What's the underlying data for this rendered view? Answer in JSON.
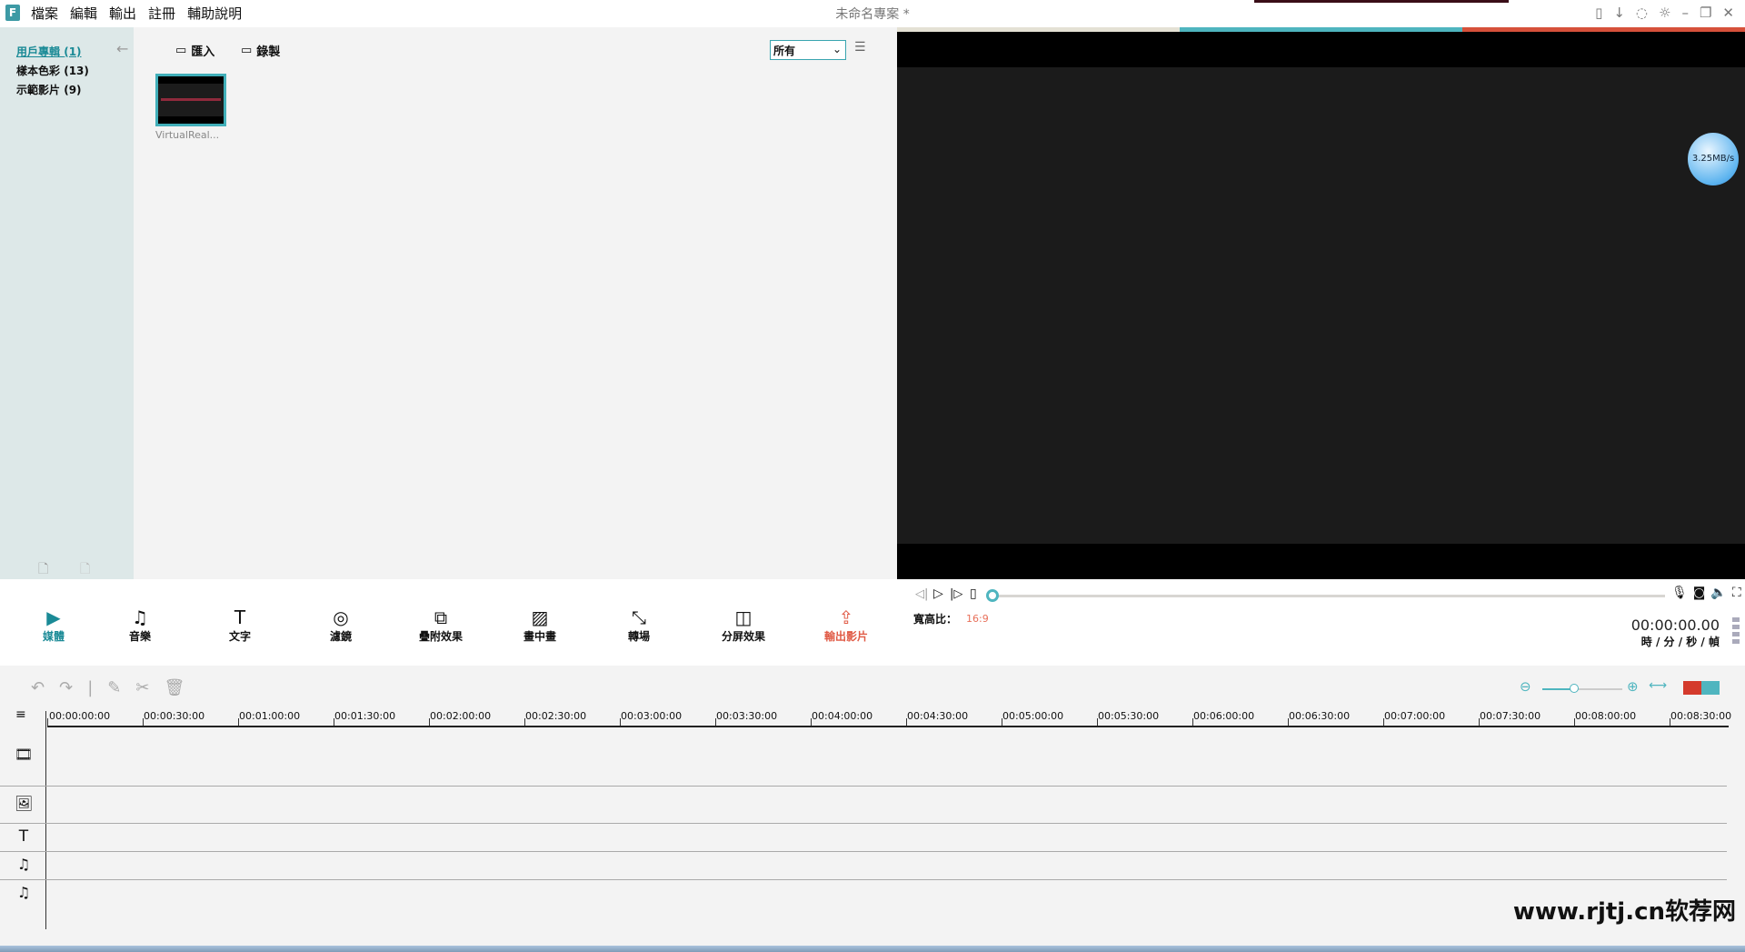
{
  "app": {
    "title": "未命名專案 *",
    "logo": "F"
  },
  "menu": [
    "檔案",
    "編輯",
    "輸出",
    "註冊",
    "輔助說明"
  ],
  "window_icons": [
    "save-icon",
    "download-icon",
    "feedback-icon",
    "theme-icon",
    "minimize-icon",
    "restore-icon",
    "close-icon"
  ],
  "sidebar": {
    "items": [
      {
        "label": "用戶專輯",
        "count": "(1)"
      },
      {
        "label": "樣本色彩",
        "count": "(13)"
      },
      {
        "label": "示範影片",
        "count": "(9)"
      }
    ]
  },
  "media": {
    "import_label": "匯入",
    "record_label": "錄製",
    "filter_value": "所有",
    "items": [
      {
        "name": "VirtualReal..."
      }
    ]
  },
  "preview": {
    "speed_badge": "3.25MB/s",
    "aspect_label": "寬高比：",
    "aspect_value": "16:9",
    "timecode": "00:00:00.00",
    "timecode_units": "時 / 分 / 秒 / 幀",
    "progress": 0,
    "color_bar": [
      "#e4e1d4",
      "#4fb5bf",
      "#d6513a"
    ]
  },
  "toolbar": [
    {
      "label": "媒體",
      "icon": "▶"
    },
    {
      "label": "音樂",
      "icon": "♫"
    },
    {
      "label": "文字",
      "icon": "T"
    },
    {
      "label": "濾鏡",
      "icon": "◎"
    },
    {
      "label": "疊附效果",
      "icon": "⧉"
    },
    {
      "label": "畫中畫",
      "icon": "▨"
    },
    {
      "label": "轉場",
      "icon": "⤡"
    },
    {
      "label": "分屏效果",
      "icon": "◫"
    },
    {
      "label": "輸出影片",
      "icon": "⇪"
    }
  ],
  "timeline": {
    "ticks": [
      "00:00:00:00",
      "00:00:30:00",
      "00:01:00:00",
      "00:01:30:00",
      "00:02:00:00",
      "00:02:30:00",
      "00:03:00:00",
      "00:03:30:00",
      "00:04:00:00",
      "00:04:30:00",
      "00:05:00:00",
      "00:05:30:00",
      "00:06:00:00",
      "00:06:30:00",
      "00:07:00:00",
      "00:07:30:00",
      "00:08:00:00",
      "00:08:30:00"
    ],
    "zoom_level": 0.4
  },
  "watermark": "www.rjtj.cn软荐网",
  "colors": {
    "accent": "#1a8a96",
    "export": "#e05a45"
  }
}
